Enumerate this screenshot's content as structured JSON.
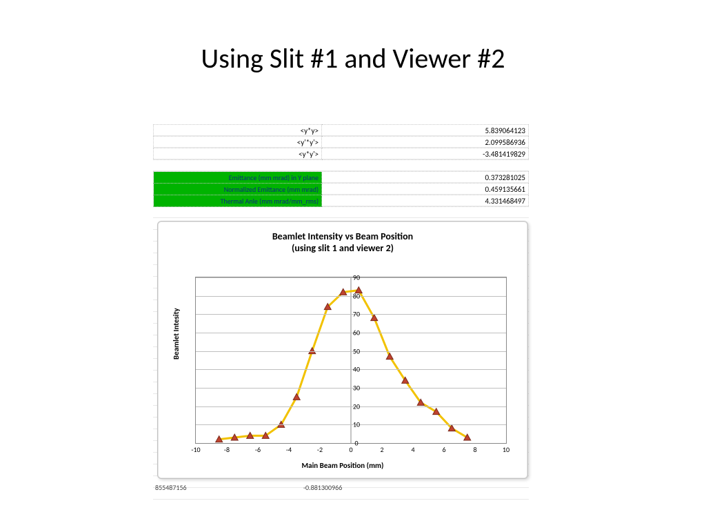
{
  "title": "Using Slit #1 and Viewer #2",
  "table": {
    "rows": [
      {
        "label": "<y*y>",
        "value": "5.839064123",
        "green": false
      },
      {
        "label": "<y'*y'>",
        "value": "2.099586936",
        "green": false
      },
      {
        "label": "<y*y'>",
        "value": "-3.481419829",
        "green": false
      }
    ],
    "rows2": [
      {
        "label": "Emittance (mm mrad) in Y plane",
        "value": "0.373281025",
        "green": true
      },
      {
        "label": "Normalized Emittance (mm mrad)",
        "value": "0.459135661",
        "green": true
      },
      {
        "label": "Thermal Anle (mm mrad/mm_rms)",
        "value": "4.331468497",
        "green": true
      }
    ]
  },
  "stray": {
    "a": "855487156",
    "b": "-0.881300966"
  },
  "chart_data": {
    "type": "line",
    "title_line1": "Beamlet  Intensity  vs  Beam  Position",
    "title_line2": "(using  slit  1  and  viewer  2)",
    "xlabel": "Main Beam Position (mm)",
    "ylabel": "Beamlet Intesity",
    "xticks": [
      -10,
      -8,
      -6,
      -4,
      -2,
      0,
      2,
      4,
      6,
      8,
      10
    ],
    "yticks": [
      0,
      10,
      20,
      30,
      40,
      50,
      60,
      70,
      80,
      90
    ],
    "xlim": [
      -10,
      10
    ],
    "ylim": [
      0,
      90
    ],
    "x": [
      -8.5,
      -7.5,
      -6.5,
      -5.5,
      -4.5,
      -3.5,
      -2.5,
      -1.5,
      -0.5,
      0.5,
      1.5,
      2.5,
      3.5,
      4.5,
      5.5,
      6.5,
      7.5
    ],
    "values": [
      2,
      3,
      4,
      4,
      10,
      25,
      50,
      74,
      82,
      83,
      68,
      47,
      34,
      22,
      17,
      8,
      3
    ],
    "line_color": "#f2c200",
    "marker_fill": "#c0432e",
    "marker_edge": "#7a2a1c"
  }
}
